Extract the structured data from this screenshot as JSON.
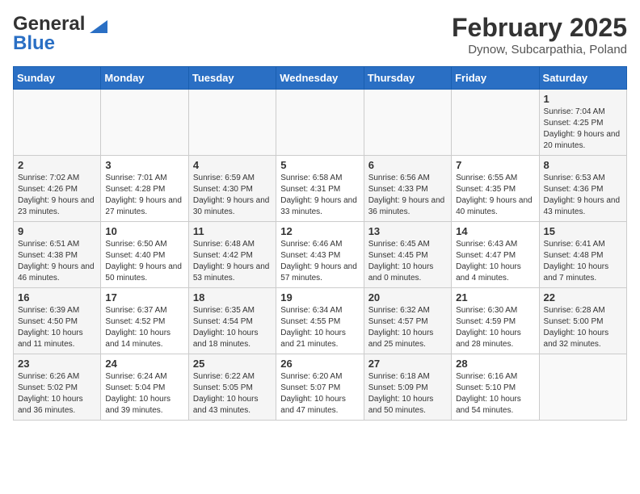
{
  "header": {
    "logo_line1": "General",
    "logo_line2": "Blue",
    "month": "February 2025",
    "location": "Dynow, Subcarpathia, Poland"
  },
  "weekdays": [
    "Sunday",
    "Monday",
    "Tuesday",
    "Wednesday",
    "Thursday",
    "Friday",
    "Saturday"
  ],
  "weeks": [
    [
      {
        "day": "",
        "info": ""
      },
      {
        "day": "",
        "info": ""
      },
      {
        "day": "",
        "info": ""
      },
      {
        "day": "",
        "info": ""
      },
      {
        "day": "",
        "info": ""
      },
      {
        "day": "",
        "info": ""
      },
      {
        "day": "1",
        "info": "Sunrise: 7:04 AM\nSunset: 4:25 PM\nDaylight: 9 hours and 20 minutes."
      }
    ],
    [
      {
        "day": "2",
        "info": "Sunrise: 7:02 AM\nSunset: 4:26 PM\nDaylight: 9 hours and 23 minutes."
      },
      {
        "day": "3",
        "info": "Sunrise: 7:01 AM\nSunset: 4:28 PM\nDaylight: 9 hours and 27 minutes."
      },
      {
        "day": "4",
        "info": "Sunrise: 6:59 AM\nSunset: 4:30 PM\nDaylight: 9 hours and 30 minutes."
      },
      {
        "day": "5",
        "info": "Sunrise: 6:58 AM\nSunset: 4:31 PM\nDaylight: 9 hours and 33 minutes."
      },
      {
        "day": "6",
        "info": "Sunrise: 6:56 AM\nSunset: 4:33 PM\nDaylight: 9 hours and 36 minutes."
      },
      {
        "day": "7",
        "info": "Sunrise: 6:55 AM\nSunset: 4:35 PM\nDaylight: 9 hours and 40 minutes."
      },
      {
        "day": "8",
        "info": "Sunrise: 6:53 AM\nSunset: 4:36 PM\nDaylight: 9 hours and 43 minutes."
      }
    ],
    [
      {
        "day": "9",
        "info": "Sunrise: 6:51 AM\nSunset: 4:38 PM\nDaylight: 9 hours and 46 minutes."
      },
      {
        "day": "10",
        "info": "Sunrise: 6:50 AM\nSunset: 4:40 PM\nDaylight: 9 hours and 50 minutes."
      },
      {
        "day": "11",
        "info": "Sunrise: 6:48 AM\nSunset: 4:42 PM\nDaylight: 9 hours and 53 minutes."
      },
      {
        "day": "12",
        "info": "Sunrise: 6:46 AM\nSunset: 4:43 PM\nDaylight: 9 hours and 57 minutes."
      },
      {
        "day": "13",
        "info": "Sunrise: 6:45 AM\nSunset: 4:45 PM\nDaylight: 10 hours and 0 minutes."
      },
      {
        "day": "14",
        "info": "Sunrise: 6:43 AM\nSunset: 4:47 PM\nDaylight: 10 hours and 4 minutes."
      },
      {
        "day": "15",
        "info": "Sunrise: 6:41 AM\nSunset: 4:48 PM\nDaylight: 10 hours and 7 minutes."
      }
    ],
    [
      {
        "day": "16",
        "info": "Sunrise: 6:39 AM\nSunset: 4:50 PM\nDaylight: 10 hours and 11 minutes."
      },
      {
        "day": "17",
        "info": "Sunrise: 6:37 AM\nSunset: 4:52 PM\nDaylight: 10 hours and 14 minutes."
      },
      {
        "day": "18",
        "info": "Sunrise: 6:35 AM\nSunset: 4:54 PM\nDaylight: 10 hours and 18 minutes."
      },
      {
        "day": "19",
        "info": "Sunrise: 6:34 AM\nSunset: 4:55 PM\nDaylight: 10 hours and 21 minutes."
      },
      {
        "day": "20",
        "info": "Sunrise: 6:32 AM\nSunset: 4:57 PM\nDaylight: 10 hours and 25 minutes."
      },
      {
        "day": "21",
        "info": "Sunrise: 6:30 AM\nSunset: 4:59 PM\nDaylight: 10 hours and 28 minutes."
      },
      {
        "day": "22",
        "info": "Sunrise: 6:28 AM\nSunset: 5:00 PM\nDaylight: 10 hours and 32 minutes."
      }
    ],
    [
      {
        "day": "23",
        "info": "Sunrise: 6:26 AM\nSunset: 5:02 PM\nDaylight: 10 hours and 36 minutes."
      },
      {
        "day": "24",
        "info": "Sunrise: 6:24 AM\nSunset: 5:04 PM\nDaylight: 10 hours and 39 minutes."
      },
      {
        "day": "25",
        "info": "Sunrise: 6:22 AM\nSunset: 5:05 PM\nDaylight: 10 hours and 43 minutes."
      },
      {
        "day": "26",
        "info": "Sunrise: 6:20 AM\nSunset: 5:07 PM\nDaylight: 10 hours and 47 minutes."
      },
      {
        "day": "27",
        "info": "Sunrise: 6:18 AM\nSunset: 5:09 PM\nDaylight: 10 hours and 50 minutes."
      },
      {
        "day": "28",
        "info": "Sunrise: 6:16 AM\nSunset: 5:10 PM\nDaylight: 10 hours and 54 minutes."
      },
      {
        "day": "",
        "info": ""
      }
    ]
  ]
}
